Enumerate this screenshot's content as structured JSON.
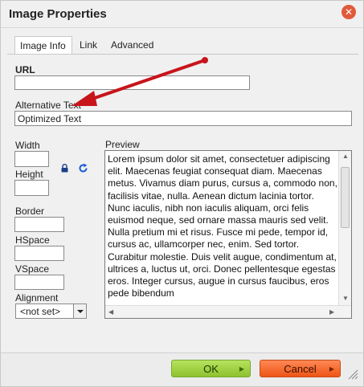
{
  "dialog": {
    "title": "Image Properties",
    "close_symbol": "✕"
  },
  "tabs": [
    {
      "label": "Image Info",
      "active": true
    },
    {
      "label": "Link",
      "active": false
    },
    {
      "label": "Advanced",
      "active": false
    }
  ],
  "form": {
    "url_label": "URL",
    "url_value": "",
    "alt_label": "Alternative Text",
    "alt_value": "Optimized Text",
    "width_label": "Width",
    "width_value": "",
    "height_label": "Height",
    "height_value": "",
    "border_label": "Border",
    "border_value": "",
    "hspace_label": "HSpace",
    "hspace_value": "",
    "vspace_label": "VSpace",
    "vspace_value": "",
    "alignment_label": "Alignment",
    "alignment_value": "<not set>"
  },
  "preview": {
    "label": "Preview",
    "text": "Lorem ipsum dolor sit amet, consectetuer adipiscing elit. Maecenas feugiat consequat diam. Maecenas metus. Vivamus diam purus, cursus a, commodo non, facilisis vitae, nulla. Aenean dictum lacinia tortor. Nunc iaculis, nibh non iaculis aliquam, orci felis euismod neque, sed ornare massa mauris sed velit. Nulla pretium mi et risus. Fusce mi pede, tempor id, cursus ac, ullamcorper nec, enim. Sed tortor. Curabitur molestie. Duis velit augue, condimentum at, ultrices a, luctus ut, orci. Donec pellentesque egestas eros. Integer cursus, augue in cursus faucibus, eros pede bibendum"
  },
  "buttons": {
    "ok_label": "OK",
    "cancel_label": "Cancel",
    "ok_color": "#9acd32",
    "cancel_color": "#f26522"
  },
  "icons": {
    "lock": "lock-icon",
    "reset": "reset-size-icon",
    "close": "close-icon",
    "annotation": "red-annotation-arrow"
  }
}
